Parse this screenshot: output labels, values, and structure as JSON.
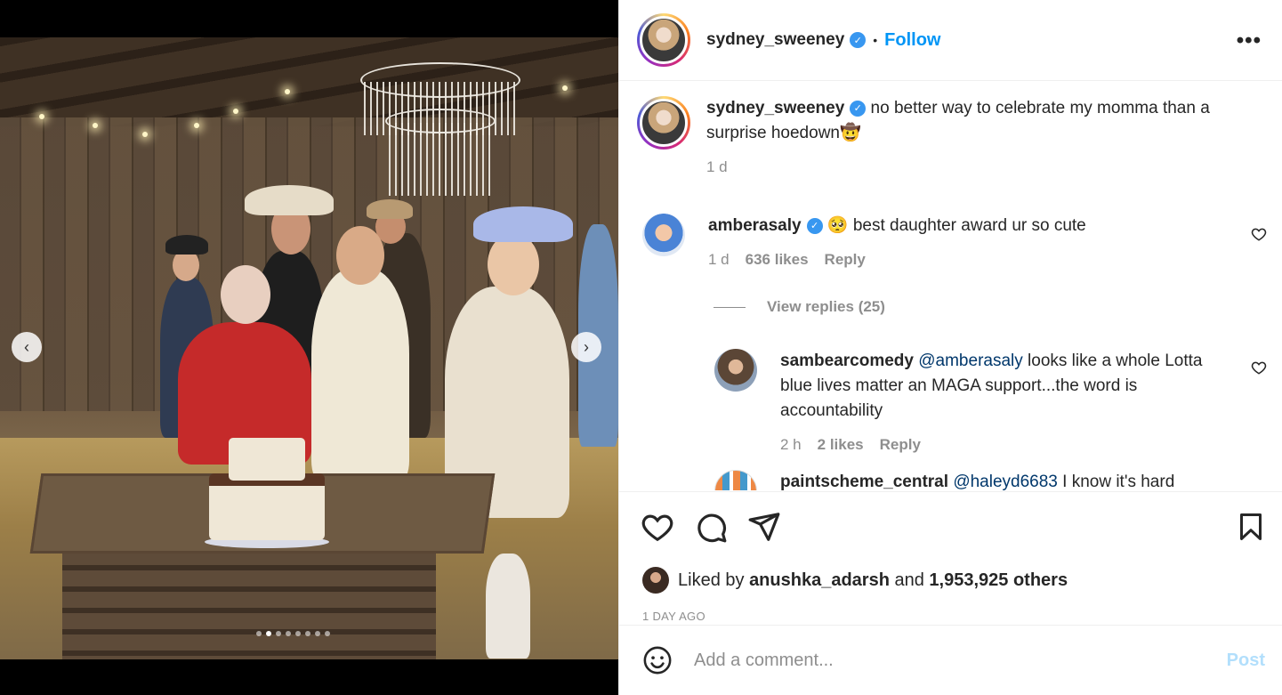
{
  "post": {
    "username": "sydney_sweeney",
    "follow_label": "Follow",
    "separator": "•",
    "more_label": "•••"
  },
  "caption": {
    "username": "sydney_sweeney",
    "text": "no better way to celebrate my momma than a surprise hoedown",
    "emoji": "🤠",
    "time": "1 d"
  },
  "comments": [
    {
      "username": "amberasaly",
      "emoji": "🥺",
      "text": "best daughter award ur so cute",
      "time": "1 d",
      "likes": "636 likes",
      "reply_label": "Reply",
      "view_replies": "View replies (25)"
    },
    {
      "username": "sambearcomedy",
      "mention": "@amberasaly",
      "text": "looks like a whole Lotta blue lives matter an MAGA support...the word is accountability",
      "time": "2 h",
      "likes": "2 likes",
      "reply_label": "Reply"
    },
    {
      "username": "paintscheme_central",
      "mention": "@haleyd6683",
      "text": "I know it's hard"
    }
  ],
  "engagement": {
    "liked_by_prefix": "Liked by",
    "liked_by_user": "anushka_adarsh",
    "and_label": "and",
    "others": "1,953,925 others",
    "date": "1 DAY AGO"
  },
  "composer": {
    "placeholder": "Add a comment...",
    "post_label": "Post"
  },
  "carousel": {
    "total": 8,
    "active_index": 1
  },
  "colors": {
    "accent": "#0095f6",
    "verified": "#3897f0",
    "muted": "#8e8e8e"
  }
}
